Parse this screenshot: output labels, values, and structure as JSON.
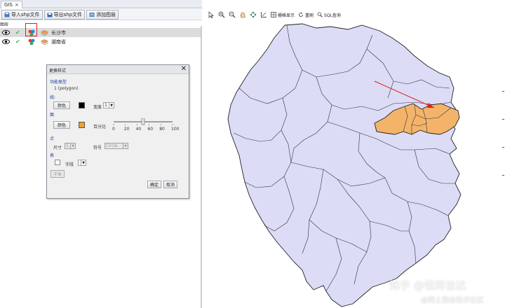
{
  "tab": {
    "label": "GIS",
    "close": "×"
  },
  "toolbar": {
    "import_label": "导入shp文件",
    "export_label": "导出shp文件",
    "add_layer_label": "添加图层"
  },
  "layers_title": "图层",
  "layers": [
    {
      "name": "长沙市",
      "selected": true
    },
    {
      "name": "湖南省",
      "selected": false
    }
  ],
  "dialog": {
    "title": "更换样式",
    "feature_type_label": "功能类型",
    "feature_type_value": "1 (polygon)",
    "line_label": "线:",
    "line_color_button": "颜色",
    "line_color": "#000000",
    "width_label": "宽度",
    "width_value": "1",
    "fill_label": "面",
    "fill_color_button": "颜色",
    "fill_color": "#f0a030",
    "percent_label": "百分比",
    "percent_value": 50,
    "slider_ticks": [
      "0",
      "20",
      "40",
      "60",
      "80",
      "100"
    ],
    "point_label": "点",
    "size_label": "尺寸",
    "size_value": "5",
    "symbol_label": "符号",
    "symbol_value": "Circle",
    "table_label": "表",
    "field_label": "字段",
    "font_button": "字体",
    "ok_button": "确定",
    "cancel_button": "取消"
  },
  "map_toolbar": {
    "raster_label": "栅格显示",
    "reset_label": "重刷",
    "sql_label": "SQL查询"
  },
  "map": {
    "province_fill": "#dcdcf7",
    "city_fill": "#f3b46a",
    "arrow_color": "#e02020"
  },
  "watermark": {
    "line1": "知乎 @恒辉信达",
    "line2": "@稀土掘金技术社区"
  }
}
